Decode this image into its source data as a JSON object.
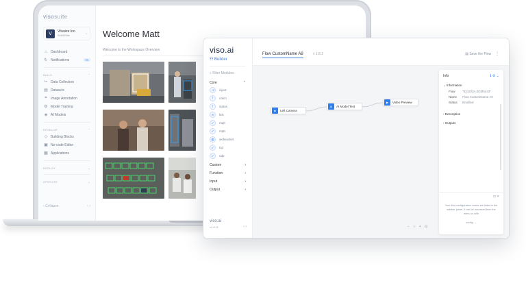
{
  "suite": {
    "logo_main": "viso",
    "logo_suffix": "suite",
    "org": {
      "initial": "V",
      "name": "Vitusize Inc.",
      "plan": "Solid Elite"
    },
    "nav_main": [
      {
        "label": "Dashboard",
        "icon": "home-icon",
        "glyph": "⌂"
      },
      {
        "label": "Notifications",
        "icon": "bell-icon",
        "glyph": "↻",
        "badge": "99"
      }
    ],
    "section_build": "BUILD",
    "nav_build": [
      {
        "label": "Data Collection",
        "icon": "scissors-icon",
        "glyph": "✂"
      },
      {
        "label": "Datasets",
        "icon": "dataset-icon",
        "glyph": "▤"
      },
      {
        "label": "Image Annotation",
        "icon": "annotation-icon",
        "glyph": "⌗"
      },
      {
        "label": "Model Training",
        "icon": "gear-icon",
        "glyph": "⚙"
      },
      {
        "label": "AI Models",
        "icon": "cube-icon",
        "glyph": "◈"
      }
    ],
    "section_develop": "DEVELOP",
    "nav_develop": [
      {
        "label": "Building Blocks",
        "icon": "blocks-icon",
        "glyph": "◇"
      },
      {
        "label": "No-code Editor",
        "icon": "editor-icon",
        "glyph": "▣"
      },
      {
        "label": "Applications",
        "icon": "apps-icon",
        "glyph": "▦"
      }
    ],
    "section_deploy": "DEPLOY",
    "section_operate": "OPERATE",
    "collapse_label": "Collapse",
    "pager": "‹  ›",
    "welcome_title": "Welcome Matt",
    "welcome_sub": "Welcome to the Workspace Overview"
  },
  "builder": {
    "logo": "viso.ai",
    "builder_label": "☷ Builder",
    "filter_placeholder": "Filter Modules",
    "core_label": "Core",
    "modules": [
      {
        "label": "inject",
        "glyph": "⇥"
      },
      {
        "label": "catch",
        "glyph": "!"
      },
      {
        "label": "status",
        "glyph": "!"
      },
      {
        "label": "link",
        "glyph": "∞"
      },
      {
        "label": "mqtt",
        "glyph": "➶"
      },
      {
        "label": "mqtt",
        "glyph": "➶"
      },
      {
        "label": "websocket",
        "glyph": "◍"
      },
      {
        "label": "tcp",
        "glyph": "➶"
      },
      {
        "label": "udp",
        "glyph": "➶"
      }
    ],
    "categories": [
      "Custom",
      "Function",
      "Input",
      "Output"
    ],
    "footer_logo": "viso.ai",
    "footer_version": "v2.8.11",
    "footer_nav": "‹   ›",
    "flow_title": "Flow CustomName A8",
    "flow_version": "v 1.8.2",
    "save_label": "Save the Flow",
    "nodes": [
      {
        "label": "Left Camera",
        "icon": "camera-icon",
        "glyph": "■"
      },
      {
        "label": "AI Model Test",
        "icon": "ai-icon",
        "glyph": "AI"
      },
      {
        "label": "Video Preview",
        "icon": "preview-icon",
        "glyph": "▶"
      }
    ],
    "zoom_controls": "−  ○  +  ⊡",
    "info": {
      "title": "Info",
      "section_information": "Information",
      "rows": [
        {
          "key": "Flow",
          "value": "\"924203A.5D3f6243\""
        },
        {
          "key": "Name",
          "value": "Flow CustomName A8"
        },
        {
          "key": "Status",
          "value": "Enabled"
        }
      ],
      "section_description": "Description",
      "section_outputs": "Outputs",
      "help_text": "Your flow configuration nodes are listed in the sidebar panel. It can be accessed from the menu or with",
      "help_link": "config   →"
    }
  }
}
